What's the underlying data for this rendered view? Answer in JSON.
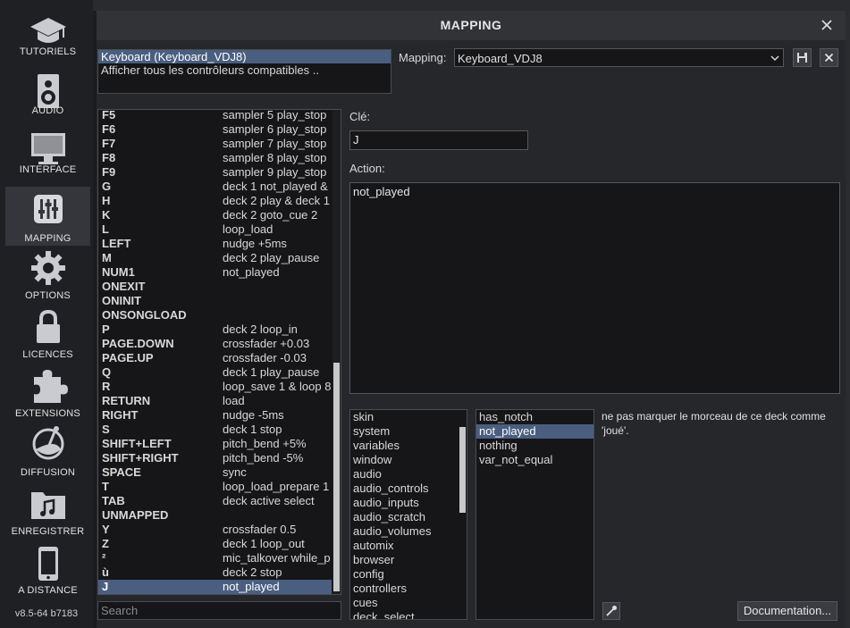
{
  "sidebar": {
    "items": [
      {
        "label": "TUTORIELS",
        "icon": "graduation-cap-icon"
      },
      {
        "label": "AUDIO",
        "icon": "speaker-icon"
      },
      {
        "label": "INTERFACE",
        "icon": "monitor-icon"
      },
      {
        "label": "MAPPING",
        "icon": "sliders-icon",
        "active": true
      },
      {
        "label": "OPTIONS",
        "icon": "gear-icon"
      },
      {
        "label": "LICENCES",
        "icon": "lock-icon"
      },
      {
        "label": "EXTENSIONS",
        "icon": "puzzle-icon"
      },
      {
        "label": "DIFFUSION",
        "icon": "satellite-icon"
      },
      {
        "label": "ENREGISTRER",
        "icon": "music-folder-icon"
      },
      {
        "label": "A DISTANCE",
        "icon": "phone-icon"
      }
    ],
    "version": "v8.5-64 b7183"
  },
  "dialog": {
    "title": "MAPPING",
    "controllers": [
      "Keyboard (Keyboard_VDJ8)",
      "Afficher tous les contrôleurs compatibles .."
    ],
    "mapping_label": "Mapping:",
    "mapping_value": "Keyboard_VDJ8",
    "key_rows": [
      {
        "key": "F5",
        "action": "sampler  5 play_stop"
      },
      {
        "key": "F6",
        "action": "sampler  6 play_stop"
      },
      {
        "key": "F7",
        "action": "sampler  7 play_stop"
      },
      {
        "key": "F8",
        "action": "sampler  8 play_stop"
      },
      {
        "key": "F9",
        "action": "sampler  9 play_stop"
      },
      {
        "key": "G",
        "action": "deck 1 not_played &"
      },
      {
        "key": "H",
        "action": "deck 2 play & deck 1"
      },
      {
        "key": "K",
        "action": "deck 2 goto_cue 2"
      },
      {
        "key": "L",
        "action": "loop_load"
      },
      {
        "key": "LEFT",
        "action": "nudge +5ms"
      },
      {
        "key": "M",
        "action": "deck 2 play_pause"
      },
      {
        "key": "NUM1",
        "action": "not_played"
      },
      {
        "key": "ONEXIT",
        "action": ""
      },
      {
        "key": "ONINIT",
        "action": ""
      },
      {
        "key": "ONSONGLOAD",
        "action": ""
      },
      {
        "key": "P",
        "action": "deck 2 loop_in"
      },
      {
        "key": "PAGE.DOWN",
        "action": "crossfader +0.03"
      },
      {
        "key": "PAGE.UP",
        "action": "crossfader -0.03"
      },
      {
        "key": "Q",
        "action": "deck 1 play_pause"
      },
      {
        "key": "R",
        "action": "loop_save 1 & loop 8"
      },
      {
        "key": "RETURN",
        "action": "load"
      },
      {
        "key": "RIGHT",
        "action": "nudge -5ms"
      },
      {
        "key": "S",
        "action": "deck 1 stop"
      },
      {
        "key": "SHIFT+LEFT",
        "action": "pitch_bend +5%"
      },
      {
        "key": "SHIFT+RIGHT",
        "action": "pitch_bend -5%"
      },
      {
        "key": "SPACE",
        "action": "sync"
      },
      {
        "key": "T",
        "action": "loop_load_prepare 1"
      },
      {
        "key": "TAB",
        "action": "deck active select"
      },
      {
        "key": "UNMAPPED",
        "action": ""
      },
      {
        "key": "Y",
        "action": "crossfader 0.5"
      },
      {
        "key": "Z",
        "action": "deck 1 loop_out"
      },
      {
        "key": "²",
        "action": "mic_talkover  while_p"
      },
      {
        "key": "ù",
        "action": "deck 2 stop"
      },
      {
        "key": "J",
        "action": "not_played",
        "selected": true
      }
    ],
    "search_placeholder": "Search",
    "key_label": "Clé:",
    "key_value": "J",
    "action_label": "Action:",
    "action_value": "not_played",
    "categories": [
      "skin",
      "system",
      "variables",
      "window",
      "audio",
      "audio_controls",
      "audio_inputs",
      "audio_scratch",
      "audio_volumes",
      "automix",
      "browser",
      "config",
      "controllers",
      "cues",
      "deck_select"
    ],
    "verbs": [
      {
        "name": "has_notch",
        "selected": false
      },
      {
        "name": "not_played",
        "selected": true
      },
      {
        "name": "nothing",
        "selected": false
      },
      {
        "name": "var_not_equal",
        "selected": false
      }
    ],
    "description": "ne pas marquer le morceau de ce deck comme 'joué'.",
    "documentation_label": "Documentation..."
  },
  "colors": {
    "selection": "#4a5f80",
    "background": "#26272b",
    "list_background": "#161618"
  }
}
